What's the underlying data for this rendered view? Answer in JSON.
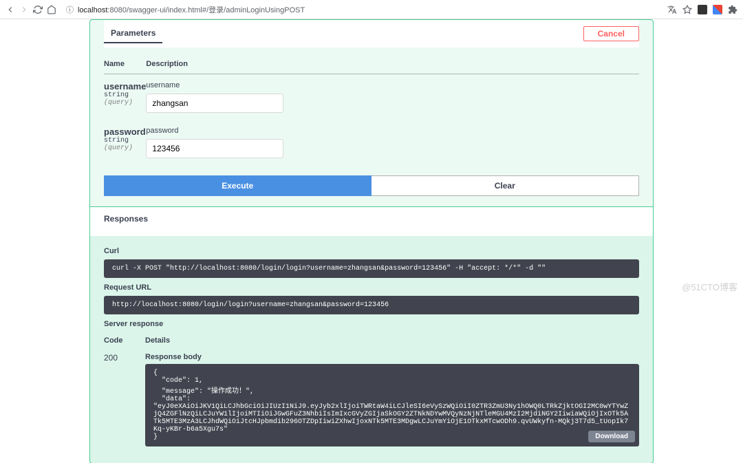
{
  "browser": {
    "url_host": "localhost",
    "url_port": ":8080",
    "url_path": "/swagger-ui/index.html#/登录/adminLoginUsingPOST",
    "info_glyph": "ⓘ"
  },
  "parameters_section": {
    "title": "Parameters",
    "cancel_label": "Cancel",
    "headers": {
      "name": "Name",
      "description": "Description"
    },
    "rows": [
      {
        "name": "username",
        "type": "string",
        "in": "(query)",
        "desc_label": "username",
        "value": "zhangsan"
      },
      {
        "name": "password",
        "type": "string",
        "in": "(query)",
        "desc_label": "password",
        "value": "123456"
      }
    ]
  },
  "actions": {
    "execute": "Execute",
    "clear": "Clear"
  },
  "responses": {
    "title": "Responses",
    "curl_label": "Curl",
    "curl_value": "curl -X POST \"http://localhost:8080/login/login?username=zhangsan&password=123456\" -H \"accept: */*\" -d \"\"",
    "request_url_label": "Request URL",
    "request_url_value": "http://localhost:8080/login/login?username=zhangsan&password=123456",
    "server_response_label": "Server response",
    "headers": {
      "code": "Code",
      "details": "Details"
    },
    "code": "200",
    "body_label": "Response body",
    "body_value": "{\n  \"code\": 1,\n  \"message\": \"操作成功！\",\n  \"data\":\n\"eyJ0eXAiOiJKV1QiLCJhbGciOiJIUzI1NiJ9.eyJyb2xlIjoiTWRtaW4iLCJleSI6eVySzWQiOiI0ZTR3ZmU3Ny1hOWQ0LTRkZjktOGI2MC0wYTYwZjQ4ZGFlNzQiLCJuYW1lIjoiMTIiOiJGwGFuZ3NhbiIsImIxcGVyZGIjaSkOGY2ZTNkNDYwMVQyNzNjNTleMGU4MzI2MjdiNGY2IiwiaWQiOjIxOTk5ATk5MTE3MzA3LCJhdWQiOiJtcHJpbmdib296OTZDpIiwiZXhwIjoxNTk5MTE3MDgwLCJuYmYiOjE1OTkxMTcwODh9.qvUWkyfn-MQkj3T7d5_tUopIk7Kq-yKBr-b6a5Xgu7s\"\n}",
    "download_label": "Download"
  },
  "watermark": "@51CTO博客"
}
